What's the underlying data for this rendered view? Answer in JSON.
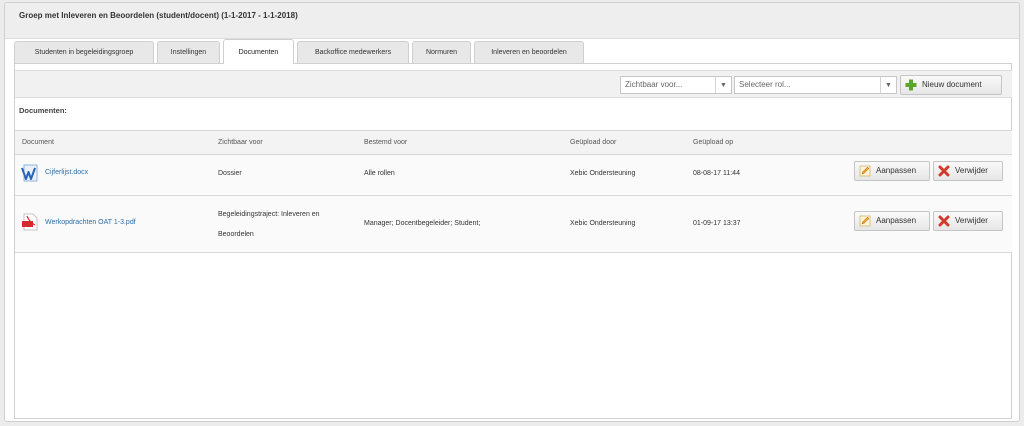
{
  "page": {
    "title": "Groep met Inleveren en Beoordelen (student/docent) (1-1-2017 - 1-1-2018)"
  },
  "tabs": [
    {
      "label": "Studenten in begeleidingsgroep",
      "active": false
    },
    {
      "label": "Instellingen",
      "active": false
    },
    {
      "label": "Documenten",
      "active": true
    },
    {
      "label": "Backoffice medewerkers",
      "active": false
    },
    {
      "label": "Normuren",
      "active": false
    },
    {
      "label": "Inleveren en beoordelen",
      "active": false
    }
  ],
  "toolbar": {
    "visible_for": {
      "placeholder": "Zichtbaar voor..."
    },
    "role": {
      "placeholder": "Selecteer rol..."
    },
    "new_document_label": "Nieuw document",
    "new_document_icon": "plus-icon"
  },
  "section": {
    "label": "Documenten:"
  },
  "table": {
    "columns": [
      "Document",
      "Zichtbaar voor",
      "Bestemd voor",
      "Geüpload door",
      "Geüpload op"
    ],
    "rows": [
      {
        "document": "Cijferlijst.docx",
        "file_icon": "word-document-icon",
        "visible_for": "Dossier",
        "intended_for": "Alle rollen",
        "uploaded_by": "Xebic Ondersteuning",
        "uploaded_on": "08-08-17 11:44",
        "edit_label": "Aanpassen",
        "delete_label": "Verwijder"
      },
      {
        "document": "Werkopdrachten OAT 1-3.pdf",
        "file_icon": "pdf-document-icon",
        "visible_for_line1": "Begeleidingstraject: Inleveren en",
        "visible_for_line2": "Beoordelen",
        "intended_for": "Manager; Docentbegeleider; Student;",
        "uploaded_by": "Xebic Ondersteuning",
        "uploaded_on": "01-09-17 13:37",
        "edit_label": "Aanpassen",
        "delete_label": "Verwijder"
      }
    ]
  },
  "colors": {
    "link": "#2d6ea8",
    "add_green": "#5aa62b",
    "delete_red": "#d23b2b",
    "pencil_orange": "#e8a43a"
  }
}
